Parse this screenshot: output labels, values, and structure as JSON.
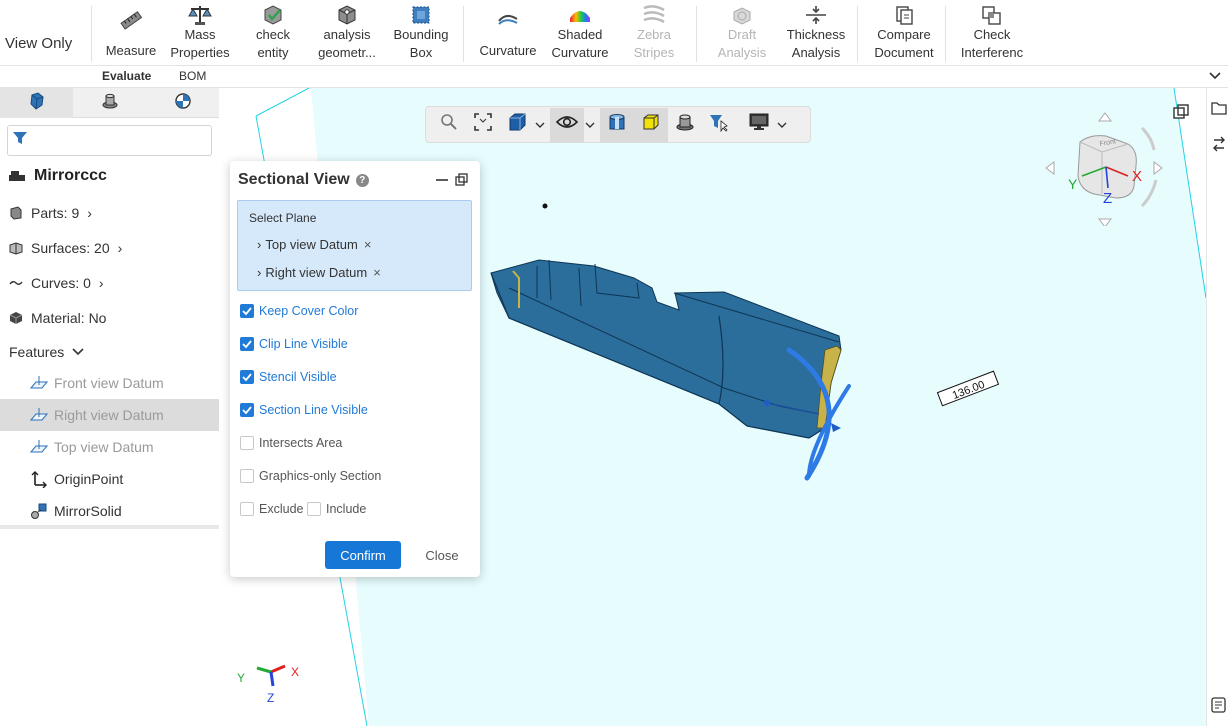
{
  "ribbon": {
    "mode_label": "View Only",
    "buttons": [
      {
        "label1": "Measure",
        "label2": ""
      },
      {
        "label1": "Mass",
        "label2": "Properties"
      },
      {
        "label1": "check",
        "label2": "entity"
      },
      {
        "label1": "analysis",
        "label2": "geometr..."
      },
      {
        "label1": "Bounding",
        "label2": "Box"
      },
      {
        "label1": "Curvature",
        "label2": ""
      },
      {
        "label1": "Shaded",
        "label2": "Curvature"
      },
      {
        "label1": "Zebra",
        "label2": "Stripes"
      },
      {
        "label1": "Draft",
        "label2": "Analysis"
      },
      {
        "label1": "Thickness",
        "label2": "Analysis"
      },
      {
        "label1": "Compare",
        "label2": "Document"
      },
      {
        "label1": "Check",
        "label2": "Interferenc"
      }
    ],
    "disabled": [
      "Zebra Stripes",
      "Draft Analysis"
    ]
  },
  "tabs": [
    {
      "label": "Evaluate",
      "active": true
    },
    {
      "label": "BOM",
      "active": false
    }
  ],
  "left_panel": {
    "filter_placeholder": "",
    "model_name": "Mirrorccc",
    "stats": {
      "parts": "Parts: 9",
      "surfaces": "Surfaces: 20",
      "curves": "Curves: 0",
      "material": "Material: No"
    },
    "features_label": "Features",
    "features": [
      {
        "label": "Front view Datum",
        "muted": true,
        "selected": false
      },
      {
        "label": "Right view Datum",
        "muted": true,
        "selected": true
      },
      {
        "label": "Top view Datum",
        "muted": true,
        "selected": false
      },
      {
        "label": "OriginPoint",
        "muted": false,
        "selected": false
      },
      {
        "label": "MirrorSolid",
        "muted": false,
        "selected": false
      }
    ]
  },
  "dialog": {
    "title": "Sectional View",
    "select_plane_label": "Select Plane",
    "planes": [
      "Top view Datum",
      "Right view Datum"
    ],
    "options": [
      {
        "label": "Keep Cover Color",
        "checked": true
      },
      {
        "label": "Clip Line Visible",
        "checked": true
      },
      {
        "label": "Stencil Visible",
        "checked": true
      },
      {
        "label": "Section Line Visible",
        "checked": true
      },
      {
        "label": "Intersects Area",
        "checked": false
      },
      {
        "label": "Graphics-only Section",
        "checked": false
      }
    ],
    "exclude_label": "Exclude",
    "include_label": "Include",
    "confirm_label": "Confirm",
    "close_label": "Close"
  },
  "viewport": {
    "dimension_text": "136.00",
    "triad": {
      "x": "X",
      "y": "Y",
      "z": "Z"
    },
    "plane_color": "#e6fcfd",
    "model_color": "#2b6d9b",
    "accent": "#1677d6"
  },
  "view_cube": {
    "x": "X",
    "y": "Y",
    "z": "Z",
    "face_label": "Front"
  }
}
